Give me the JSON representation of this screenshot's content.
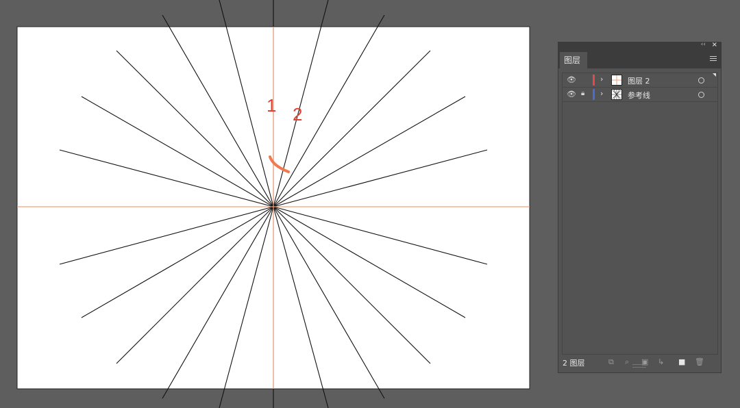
{
  "canvas": {
    "annotations": [
      "1",
      "2"
    ]
  },
  "layers_panel": {
    "tab_label": "图层",
    "collapse_icon": "double-chevron-left-icon",
    "close_icon": "close-icon",
    "menu_icon": "hamburger-menu-icon",
    "layers": [
      {
        "name": "图层 2",
        "color": "#e8474b",
        "locked": false
      },
      {
        "name": "参考线",
        "color": "#4a6bd8",
        "locked": true
      }
    ],
    "footer": {
      "count_label": "2 图层",
      "icons": [
        "export-icon",
        "search-icon",
        "clipping-mask-icon",
        "new-sublayer-icon",
        "new-layer-icon",
        "trash-icon"
      ]
    }
  },
  "colors": {
    "workspace_bg": "#5e5e5e",
    "artboard": "#ffffff",
    "guide": "#f2a27a",
    "annotation": "#e63e2f"
  }
}
